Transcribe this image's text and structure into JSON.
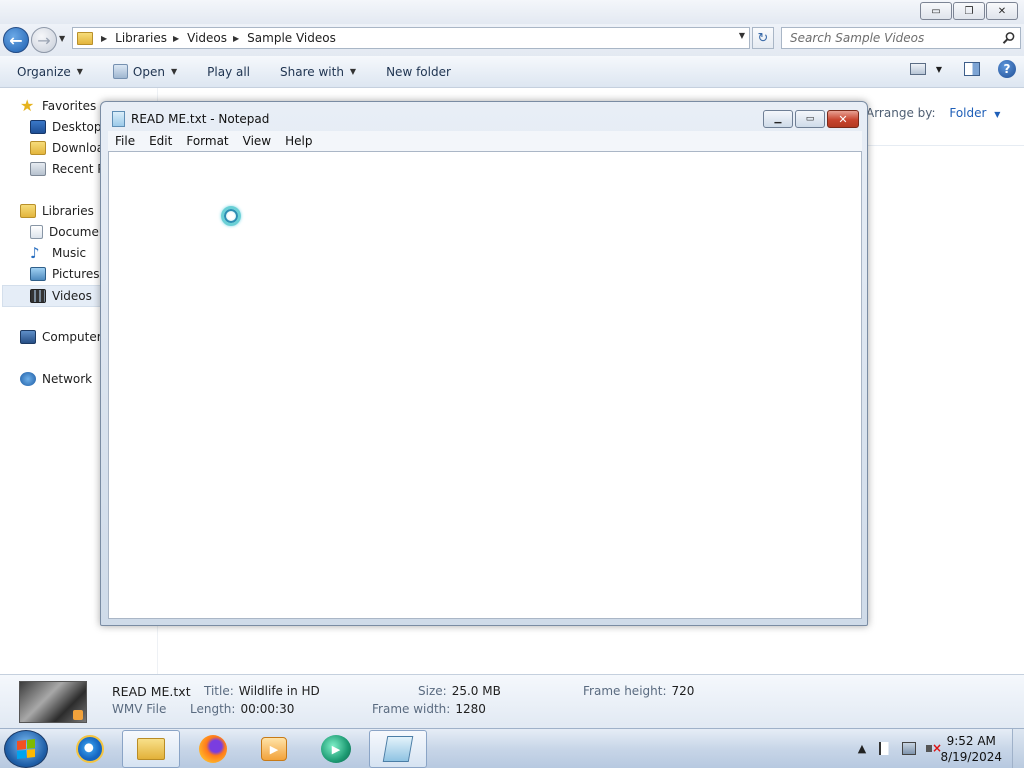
{
  "explorer": {
    "window_controls": {
      "minimize": "▭",
      "maximize": "❐",
      "close": "✕"
    },
    "breadcrumb": [
      "Libraries",
      "Videos",
      "Sample Videos"
    ],
    "search_placeholder": "Search Sample Videos",
    "commands": {
      "organize": "Organize",
      "open": "Open",
      "play_all": "Play all",
      "share_with": "Share with",
      "new_folder": "New folder"
    },
    "nav": {
      "favorites": "Favorites",
      "desktop": "Desktop",
      "downloads": "Downloa",
      "recent": "Recent Pl",
      "libraries": "Libraries",
      "documents": "Documer",
      "music": "Music",
      "pictures": "Pictures",
      "videos": "Videos",
      "computer": "Computer",
      "network": "Network"
    },
    "arrange_label": "Arrange by:",
    "arrange_value": "Folder",
    "details": {
      "filename": "READ ME.txt",
      "filetype": "WMV File",
      "title_label": "Title:",
      "title_value": "Wildlife in HD",
      "length_label": "Length:",
      "length_value": "00:00:30",
      "size_label": "Size:",
      "size_value": "25.0 MB",
      "frame_width_label": "Frame width:",
      "frame_width_value": "1280",
      "frame_height_label": "Frame height:",
      "frame_height_value": "720"
    }
  },
  "notepad": {
    "title": "READ ME.txt - Notepad",
    "menu": [
      "File",
      "Edit",
      "Format",
      "View",
      "Help"
    ],
    "content": ""
  },
  "taskbar": {
    "clock_time": "9:52 AM",
    "clock_date": "8/19/2024",
    "tray_expand": "▲"
  },
  "colors": {
    "accent_link": "#1f5fb8",
    "close_button": "#c8452f"
  }
}
